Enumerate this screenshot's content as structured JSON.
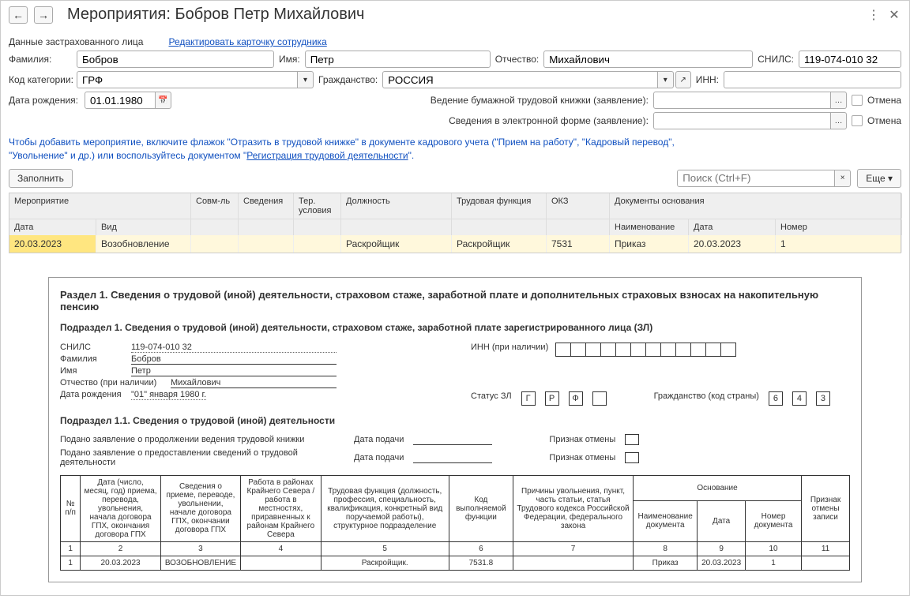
{
  "titlebar": {
    "title": "Мероприятия: Бобров Петр Михайлович"
  },
  "topLinks": {
    "insured_label": "Данные застрахованного лица",
    "edit_card": "Редактировать карточку сотрудника"
  },
  "form": {
    "lastname_label": "Фамилия:",
    "lastname": "Бобров",
    "firstname_label": "Имя:",
    "firstname": "Петр",
    "middlename_label": "Отчество:",
    "middlename": "Михайлович",
    "snils_label": "СНИЛС:",
    "snils": "119-074-010 32",
    "category_label": "Код категории:",
    "category": "ГРФ",
    "citizenship_label": "Гражданство:",
    "citizenship": "РОССИЯ",
    "inn_label": "ИНН:",
    "birth_label": "Дата рождения:",
    "birth": "01.01.1980",
    "paper_book_label": "Ведение бумажной трудовой книжки (заявление):",
    "electronic_label": "Сведения в электронной форме (заявление):",
    "cancel_label": "Отмена"
  },
  "hint": {
    "line1a": "Чтобы добавить мероприятие, включите флажок \"Отразить в трудовой книжке\" в документе кадрового учета (\"Прием на работу\", \"Кадровый перевод\",",
    "line2a": "\"Увольнение\" и др.) или воспользуйтесь документом \"",
    "link": "Регистрация трудовой деятельности",
    "line2b": "\"."
  },
  "toolbar": {
    "fill": "Заполнить",
    "search_placeholder": "Поиск (Ctrl+F)",
    "more": "Еще"
  },
  "grid": {
    "heads": {
      "event": "Мероприятие",
      "sovm": "Совм-ль",
      "info": "Сведения",
      "ter": "Тер. условия",
      "position": "Должность",
      "func": "Трудовая функция",
      "okz": "ОКЗ",
      "docs": "Документы основания",
      "date": "Дата",
      "type": "Вид",
      "doc_name": "Наименование",
      "doc_date": "Дата",
      "doc_num": "Номер"
    },
    "row": {
      "date": "20.03.2023",
      "type": "Возобновление",
      "position": "Раскройщик",
      "func": "Раскройщик",
      "okz": "7531",
      "doc_name": "Приказ",
      "doc_date": "20.03.2023",
      "doc_num": "1"
    }
  },
  "report": {
    "section1": "Раздел 1. Сведения о трудовой (иной) деятельности, страховом стаже, заработной плате и дополнительных страховых взносах на накопительную пенсию",
    "subsection1": "Подраздел 1. Сведения о трудовой (иной) деятельности, страховом стаже, заработной плате зарегистрированного лица (ЗЛ)",
    "snils_lbl": "СНИЛС",
    "snils": "119-074-010 32",
    "inn_lbl": "ИНН (при наличии)",
    "lastname_lbl": "Фамилия",
    "lastname": "Бобров",
    "firstname_lbl": "Имя",
    "firstname": "Петр",
    "middlename_lbl": "Отчество (при наличии)",
    "middlename": "Михайлович",
    "birth_lbl": "Дата рождения",
    "birth_q": "\"01\" января 1980 г.",
    "status_lbl": "Статус ЗЛ",
    "status_codes": [
      "Г",
      "Р",
      "Ф"
    ],
    "citizenship_lbl": "Гражданство (код страны)",
    "citizenship_codes": [
      "6",
      "4",
      "3"
    ],
    "subsection11": "Подраздел 1.1. Сведения о трудовой (иной) деятельности",
    "paper_stmt": "Подано заявление о продолжении ведения трудовой книжки",
    "electronic_stmt": "Подано заявление о предоставлении сведений о трудовой деятельности",
    "submitted_lbl": "Дата подачи",
    "cancel_flag_lbl": "Признак отмены",
    "table": {
      "headers": {
        "num": "№ п/п",
        "date": "Дата (число, месяц, год) приема, перевода, увольнения, начала договора ГПХ, окончания договора ГПХ",
        "info": "Сведения о приеме, переводе, увольнении, начале договора ГПХ, окончании договора ГПХ",
        "north": "Работа в районах Крайнего Севера / работа в местностях, приравненных к районам Крайнего Севера",
        "func": "Трудовая функция (должность, профессия, специальность, квалификация, конкретный вид поручаемой работы), структурное подразделение",
        "code": "Код выполняемой функции",
        "reason": "Причины увольнения, пункт, часть статьи, статья Трудового кодекса Российской Федерации, федерального закона",
        "basis": "Основание",
        "doc_name": "Наименование документа",
        "doc_date": "Дата",
        "doc_num": "Номер документа",
        "cancel": "Признак отмены записи"
      },
      "nums": [
        "1",
        "2",
        "3",
        "4",
        "5",
        "6",
        "7",
        "8",
        "9",
        "10",
        "11"
      ],
      "data": {
        "num": "1",
        "date": "20.03.2023",
        "info": "ВОЗОБНОВЛЕНИЕ",
        "func": "Раскройщик.",
        "code": "7531.8",
        "doc_name": "Приказ",
        "doc_date": "20.03.2023",
        "doc_num": "1"
      }
    }
  }
}
